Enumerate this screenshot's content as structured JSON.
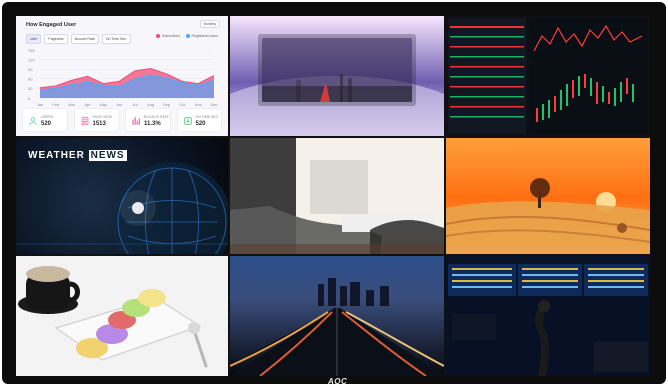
{
  "brand": "AOC",
  "dashboard": {
    "title": "How Engaged User",
    "tabs": [
      "User",
      "Pageview",
      "Bounce Rate",
      "On Time Sec."
    ],
    "active_tab": "User",
    "dropdown": "Monthly",
    "legend": [
      {
        "name": "Subscribed",
        "color": "#f04d7a"
      },
      {
        "name": "Registered users",
        "color": "#4aa7ff"
      }
    ],
    "chart_data": {
      "type": "area",
      "x": [
        "Jan",
        "Feb",
        "Mar",
        "Apr",
        "May",
        "Jun",
        "Jul",
        "Aug",
        "Sep",
        "Oct",
        "Nov",
        "Dec"
      ],
      "ylim": [
        0,
        150
      ],
      "yticks": [
        0,
        30,
        60,
        90,
        120,
        150
      ],
      "series": [
        {
          "name": "Subscribed",
          "values": [
            32,
            38,
            55,
            68,
            45,
            52,
            85,
            92,
            75,
            52,
            45,
            70
          ],
          "color": "#f04d7a"
        },
        {
          "name": "Registered users",
          "values": [
            25,
            30,
            42,
            50,
            40,
            35,
            60,
            70,
            62,
            48,
            40,
            55
          ],
          "color": "#4aa7ff"
        }
      ]
    },
    "kpis": [
      {
        "label": "USERS",
        "value": "520",
        "color": "#6fd0c8"
      },
      {
        "label": "PAGE VIEW",
        "value": "1513",
        "color": "#f06aa5"
      },
      {
        "label": "BOUNCE RATE",
        "value": "11.3%",
        "color": "#f06aa5"
      },
      {
        "label": "ON TIME SEC",
        "value": "520",
        "color": "#55c77a"
      }
    ]
  },
  "weather": {
    "title_left": "WEATHER",
    "title_right": "NEWS"
  },
  "market": {
    "panels": [
      {
        "name": "price-grid"
      },
      {
        "name": "candles"
      }
    ]
  }
}
